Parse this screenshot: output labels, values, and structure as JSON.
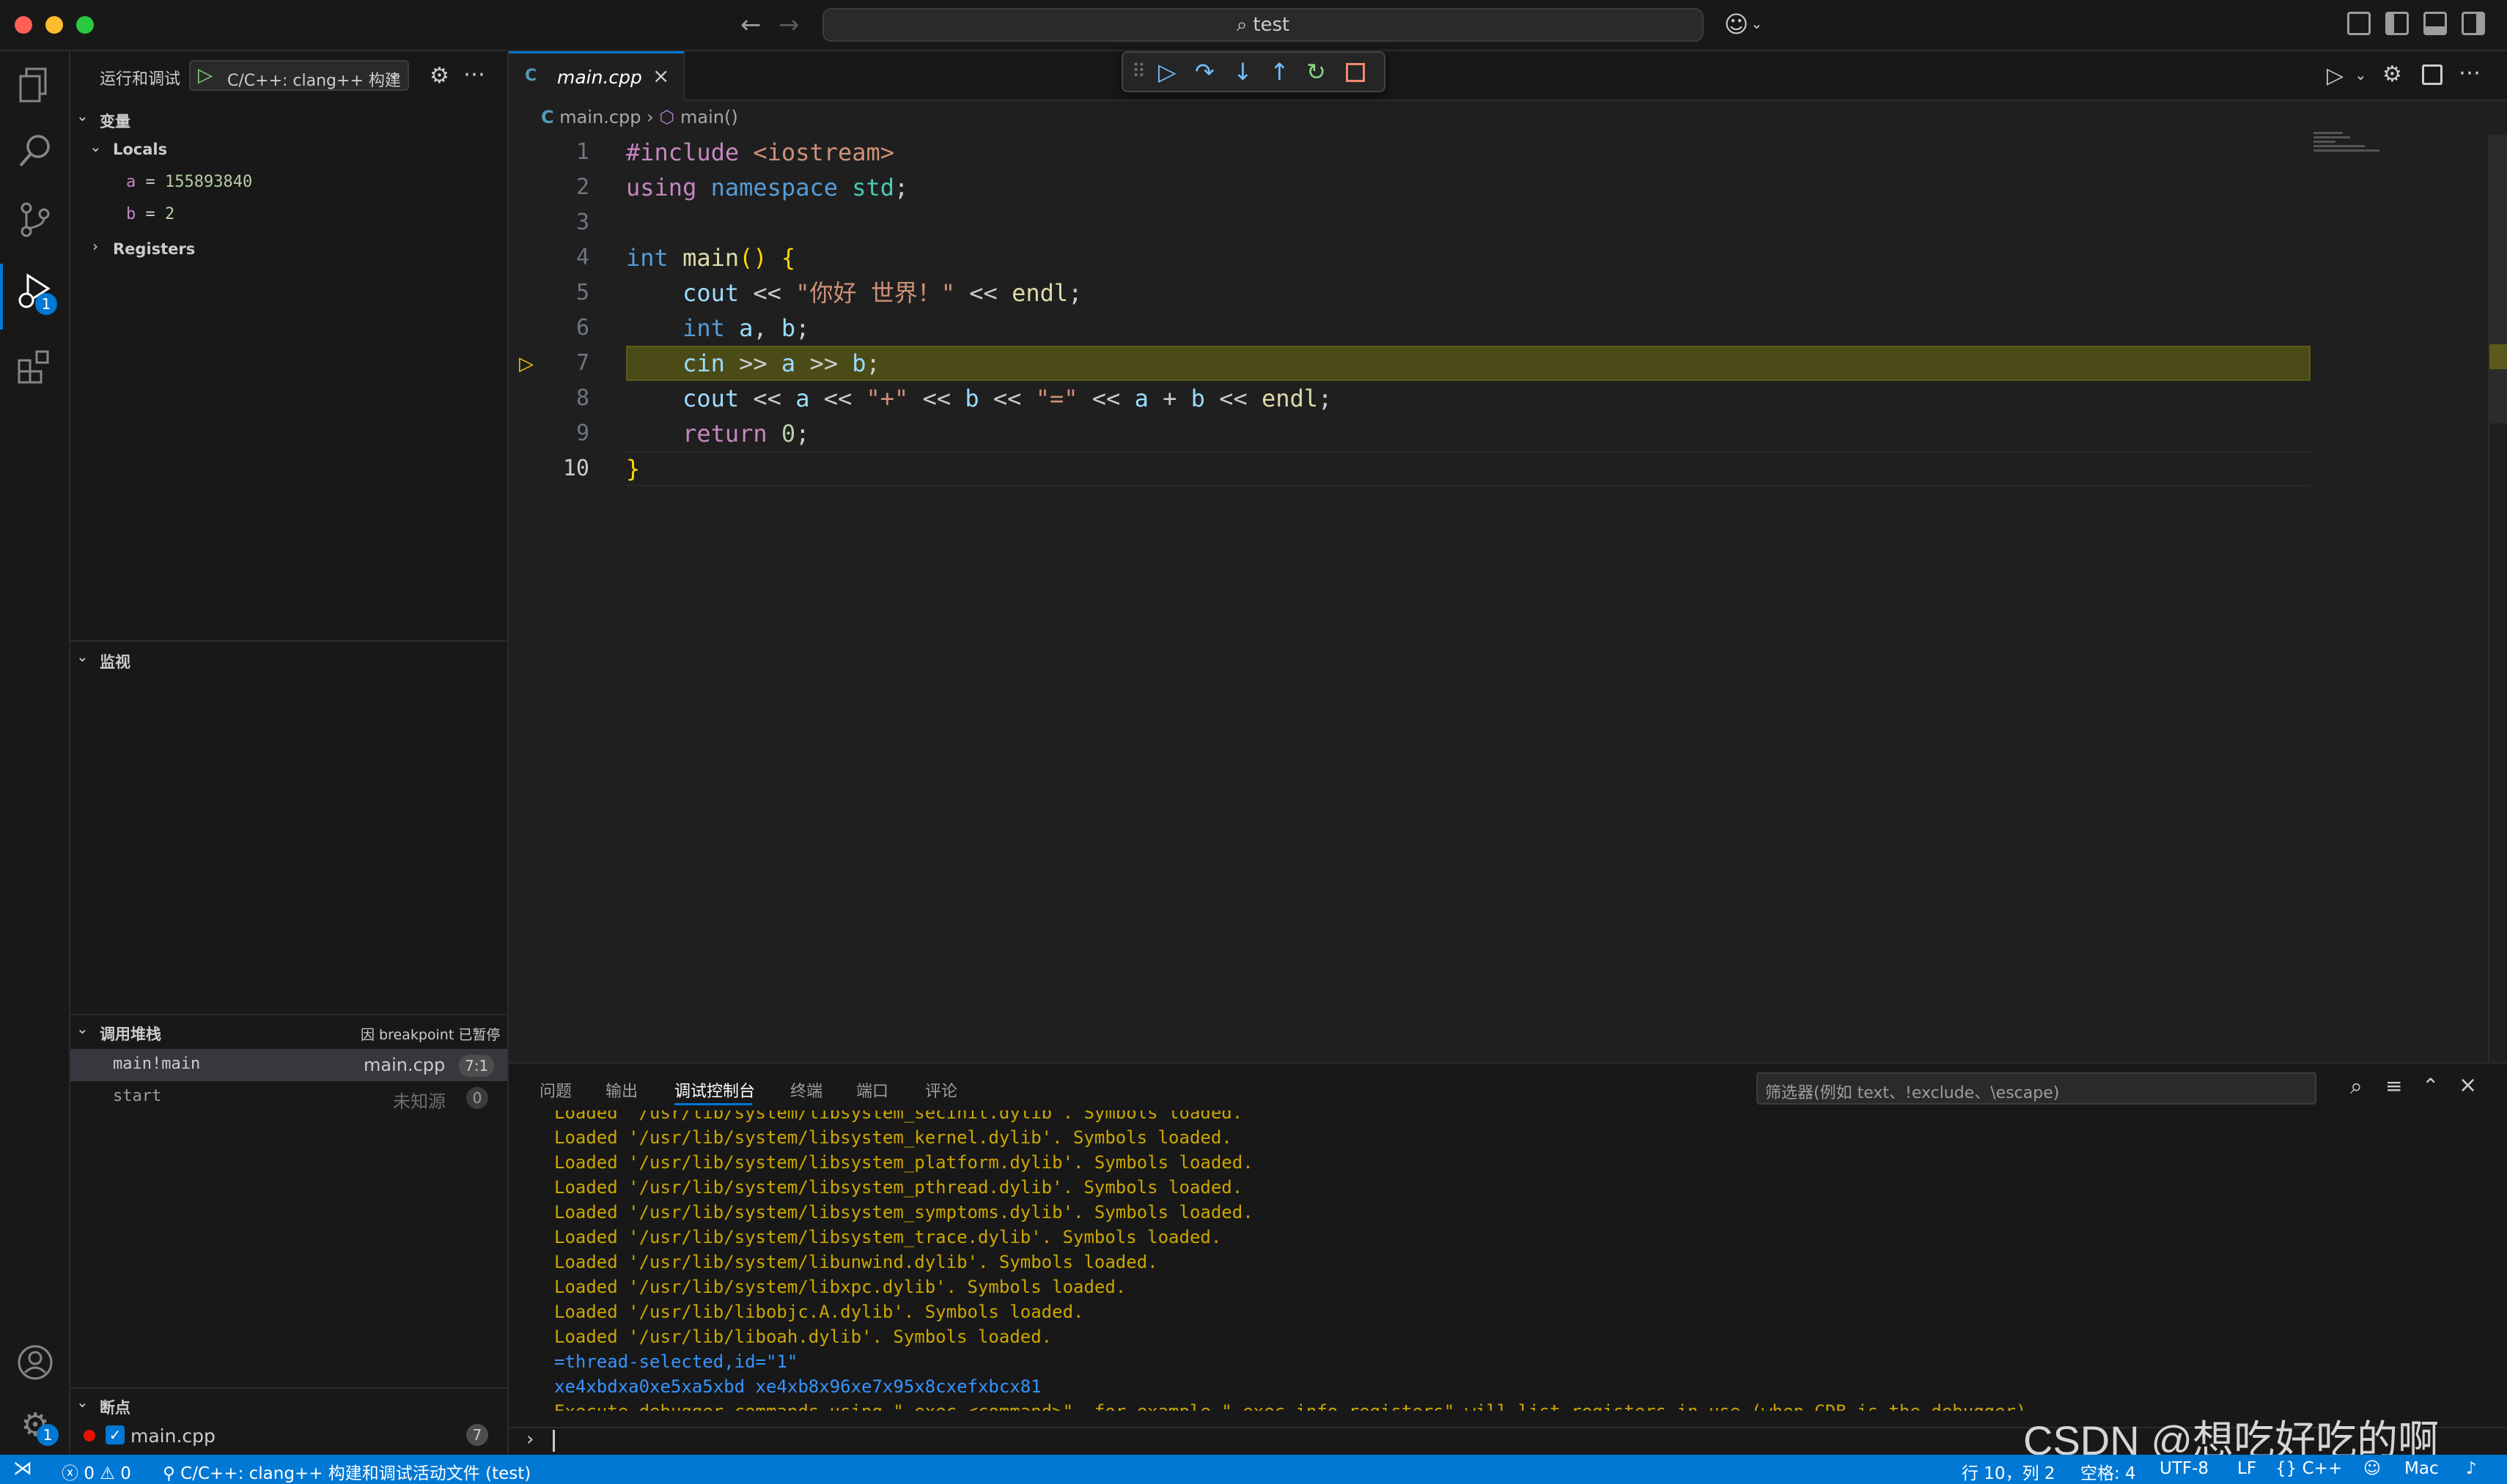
{
  "titlebar": {
    "search_text": "test",
    "colors": {
      "close": "#ff5f57",
      "minimize": "#febc2e",
      "zoom": "#28c840"
    }
  },
  "activity": {
    "icons": [
      "explorer-icon",
      "search-icon",
      "source-control-icon",
      "run-debug-icon",
      "extensions-icon",
      "accounts-icon",
      "manage-gear-icon"
    ],
    "debug_badge": "1",
    "settings_badge": "1"
  },
  "sidebar": {
    "title": "运行和调试",
    "config_name": "C/C++: clang++ 构建",
    "variables_header": "变量",
    "locals_header": "Locals",
    "locals": [
      {
        "name": "a",
        "value": "155893840"
      },
      {
        "name": "b",
        "value": "2"
      }
    ],
    "registers_header": "Registers",
    "watch_header": "监视",
    "callstack_header": "调用堆栈",
    "callstack_status": "因 breakpoint 已暂停",
    "frames": [
      {
        "name": "main!main",
        "file": "main.cpp",
        "pos": "7:1"
      },
      {
        "name": "start",
        "file": "未知源",
        "pos": "0"
      }
    ],
    "breakpoints_header": "断点",
    "breakpoint_file": "main.cpp",
    "breakpoint_count": "7"
  },
  "editor": {
    "tab_label": "main.cpp",
    "breadcrumb_file": "main.cpp",
    "breadcrumb_symbol": "main()",
    "line_numbers": [
      "1",
      "2",
      "3",
      "4",
      "5",
      "6",
      "7",
      "8",
      "9",
      "10"
    ],
    "current_line": "7"
  },
  "panel": {
    "tabs": [
      "问题",
      "输出",
      "调试控制台",
      "终端",
      "端口",
      "评论"
    ],
    "active_tab": "调试控制台",
    "filter_placeholder": "筛选器(例如 text、!exclude、\\escape)",
    "logs": [
      "Loaded '/usr/lib/system/libsystem_secinit.dylib'. Symbols loaded.",
      "Loaded '/usr/lib/system/libsystem_kernel.dylib'. Symbols loaded.",
      "Loaded '/usr/lib/system/libsystem_platform.dylib'. Symbols loaded.",
      "Loaded '/usr/lib/system/libsystem_pthread.dylib'. Symbols loaded.",
      "Loaded '/usr/lib/system/libsystem_symptoms.dylib'. Symbols loaded.",
      "Loaded '/usr/lib/system/libsystem_trace.dylib'. Symbols loaded.",
      "Loaded '/usr/lib/system/libunwind.dylib'. Symbols loaded.",
      "Loaded '/usr/lib/system/libxpc.dylib'. Symbols loaded.",
      "Loaded '/usr/lib/libobjc.A.dylib'. Symbols loaded.",
      "Loaded '/usr/lib/liboah.dylib'. Symbols loaded."
    ],
    "thread_line": "=thread-selected,id=\"1\"",
    "hex_line": "xe4xbdxa0xe5xa5xbd xe4xb8x96xe7x95x8cxefxbcx81",
    "exec_line": "Execute debugger commands using \"-exec <command>\", for example \"-exec info registers\" will list registers in use (when GDB is the debugger)"
  },
  "statusbar": {
    "errors": "0",
    "warnings": "0",
    "debug_config": "C/C++: clang++ 构建和调试活动文件 (test)",
    "position": "行 10，列 2",
    "spaces": "空格: 4",
    "encoding": "UTF-8",
    "eol": "LF",
    "language": "C++",
    "platform": "Mac"
  },
  "watermark": "CSDN @想吃好吃的啊"
}
